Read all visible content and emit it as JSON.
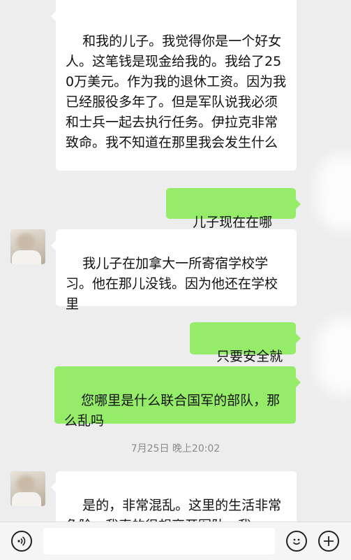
{
  "messages": {
    "m1": "和我的儿子。我觉得你是一个好女人。这笔钱是现金给我的。我给了250万美元。作为我的退休工资。因为我已经服役多年了。但是军队说我必须和士兵一起去执行任务。伊拉克非常致命。我不知道在那里我会发生什么",
    "m2": "儿子现在在哪里？",
    "m3": "我儿子在加拿大一所寄宿学校学习。他在那儿没钱。因为他还在学校里",
    "m4": "只要安全就好",
    "m5": "您哪里是什么联合国军的部队，那么乱吗",
    "m6": "是的，非常混乱。这里的生活非常危险。我真的很想离开军队。我"
  },
  "timestamp": "7月25日 晚上20:02",
  "icons": {
    "voice": "voice-icon",
    "emoji": "emoji-icon",
    "plus": "plus-icon"
  },
  "colors": {
    "background": "#ededed",
    "sent_bubble": "#95ec69",
    "received_bubble": "#ffffff"
  }
}
